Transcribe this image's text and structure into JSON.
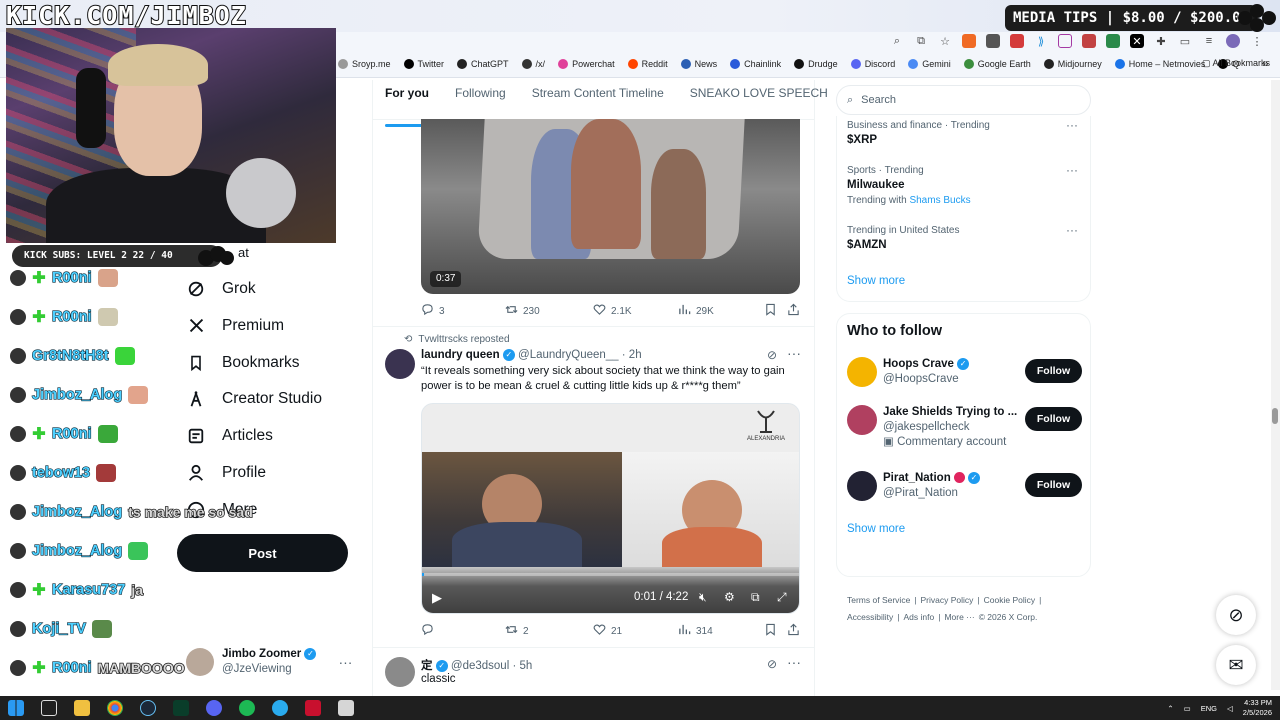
{
  "overlay": {
    "title": "KICK.COM/JIMBOZ",
    "media_tips": "MEDIA TIPS | $8.00 / $200.00",
    "sub_progress": "KICK SUBS: LEVEL 2 22 / 40",
    "sub_fraction": 0.55
  },
  "browser": {
    "bookmarks": [
      {
        "label": "Sroyp.me",
        "icon": "bookmark-icon",
        "color": "#999999"
      },
      {
        "label": "Twitter",
        "icon": "x-logo-icon",
        "color": "#000000"
      },
      {
        "label": "ChatGPT",
        "icon": "chatgpt-icon",
        "color": "#222222"
      },
      {
        "label": "/x/",
        "icon": "grid-icon",
        "color": "#333333"
      },
      {
        "label": "Powerchat",
        "icon": "powerchat-icon",
        "color": "#e0409a"
      },
      {
        "label": "Reddit",
        "icon": "reddit-icon",
        "color": "#ff4500"
      },
      {
        "label": "News",
        "icon": "news-icon",
        "color": "#2b5fb4"
      },
      {
        "label": "Chainlink",
        "icon": "chainlink-icon",
        "color": "#2a5ada"
      },
      {
        "label": "Drudge",
        "icon": "drudge-icon",
        "color": "#111111"
      },
      {
        "label": "Discord",
        "icon": "discord-icon",
        "color": "#5865f2"
      },
      {
        "label": "Gemini",
        "icon": "gemini-icon",
        "color": "#4a8af4"
      },
      {
        "label": "Google Earth",
        "icon": "google-earth-icon",
        "color": "#3c8e3e"
      },
      {
        "label": "Midjourney",
        "icon": "midjourney-icon",
        "color": "#222222"
      },
      {
        "label": "Home – Netmovies",
        "icon": "netmovies-icon",
        "color": "#1a73e8"
      },
      {
        "label": "Q",
        "icon": "q-icon",
        "color": "#000000"
      }
    ],
    "all_bookmarks": "All Bookmarks"
  },
  "chat": [
    {
      "name": "R00ni",
      "badge": true,
      "message": "",
      "emote": "#d9a38a"
    },
    {
      "name": "R00ni",
      "badge": true,
      "message": "",
      "emote": "#cfc9b0"
    },
    {
      "name": "Gr8tN8tH8t",
      "badge": false,
      "message": "",
      "emote": "#3ad43a"
    },
    {
      "name": "Jimboz_Alog",
      "badge": false,
      "message": "",
      "emote": "#e2a48c"
    },
    {
      "name": "R00ni",
      "badge": true,
      "message": "",
      "emote": "#3aa83a"
    },
    {
      "name": "tebow13",
      "badge": false,
      "message": "",
      "emote": "#a33a3a"
    },
    {
      "name": "Jimboz_Alog",
      "badge": false,
      "message": "ts make me so sad",
      "emote": ""
    },
    {
      "name": "Jimboz_Alog",
      "badge": false,
      "message": "",
      "emote": "#3ac45a"
    },
    {
      "name": "Karasu737",
      "badge": true,
      "message": "ja",
      "emote": ""
    },
    {
      "name": "Koji_TV",
      "badge": false,
      "message": "",
      "emote": "#5a8a4a"
    },
    {
      "name": "R00ni",
      "badge": true,
      "message": "MAMBOOOO",
      "emote": ""
    }
  ],
  "nav": {
    "partial_top": "at",
    "items": [
      {
        "label": "Grok",
        "icon": "grok-icon"
      },
      {
        "label": "Premium",
        "icon": "x-logo-icon"
      },
      {
        "label": "Bookmarks",
        "icon": "bookmark-icon"
      },
      {
        "label": "Creator Studio",
        "icon": "creator-studio-icon"
      },
      {
        "label": "Articles",
        "icon": "articles-icon"
      },
      {
        "label": "Profile",
        "icon": "person-icon"
      },
      {
        "label": "More",
        "icon": "more-circle-icon"
      }
    ],
    "post": "Post",
    "account_name": "Jimbo Zoomer",
    "account_handle": "@JzeViewing"
  },
  "timeline": {
    "tabs": [
      "For you",
      "Following",
      "Stream Content Timeline",
      "SNEAKO LOVE SPEECH"
    ],
    "active_tab": 0,
    "tweet1": {
      "duration": "0:37",
      "replies": "3",
      "reposts": "230",
      "likes": "2.1K",
      "views": "29K"
    },
    "tweet2": {
      "repost_label": "Tvwlttrscks reposted",
      "name": "laundry queen",
      "handle": "@LaundryQueen__",
      "time": "· 2h",
      "text": "“It reveals something very sick about society that we think the way to gain power is to be mean & cruel & cutting little kids up & r****g them”",
      "video_time": "0:01 / 4:22",
      "video_progress": 0.004,
      "logo_text": "ALEXANDRIA",
      "replies": "",
      "reposts": "2",
      "likes": "21",
      "views": "314"
    },
    "tweet3": {
      "name": "定",
      "handle": "@de3dsoul",
      "time": "· 5h",
      "text": "classic"
    }
  },
  "sidebar": {
    "search_placeholder": "Search",
    "trends": [
      {
        "meta": "Business and finance · Trending",
        "name": "$XRP",
        "with_label": "",
        "with": []
      },
      {
        "meta": "Sports · Trending",
        "name": "Milwaukee",
        "with_label": "Trending with",
        "with": [
          "Shams",
          "Bucks"
        ]
      },
      {
        "meta": "Trending in United States",
        "name": "$AMZN",
        "with_label": "",
        "with": []
      }
    ],
    "show_more": "Show more",
    "who_to_follow": "Who to follow",
    "follow_suggestions": [
      {
        "name": "Hoops Crave",
        "handle": "@HoopsCrave",
        "extra": "",
        "avatar": "#f4b400"
      },
      {
        "name": "Jake Shields Trying to ...",
        "handle": "@jakespellcheck",
        "extra": "Commentary account",
        "avatar": "#b04060"
      },
      {
        "name": "Pirat_Nation",
        "handle": "@Pirat_Nation",
        "extra": "",
        "avatar": "#222233"
      }
    ],
    "follow_label": "Follow",
    "show_more_2": "Show more",
    "footer": {
      "line1": [
        "Terms of Service",
        "|",
        "Privacy Policy",
        "|",
        "Cookie Policy",
        "|"
      ],
      "line2": [
        "Accessibility",
        "|",
        "Ads info",
        "|",
        "More ···",
        "© 2026 X Corp."
      ]
    }
  },
  "taskbar": {
    "lang": "ENG",
    "time": "4:33 PM",
    "date": "2/5/2026"
  }
}
